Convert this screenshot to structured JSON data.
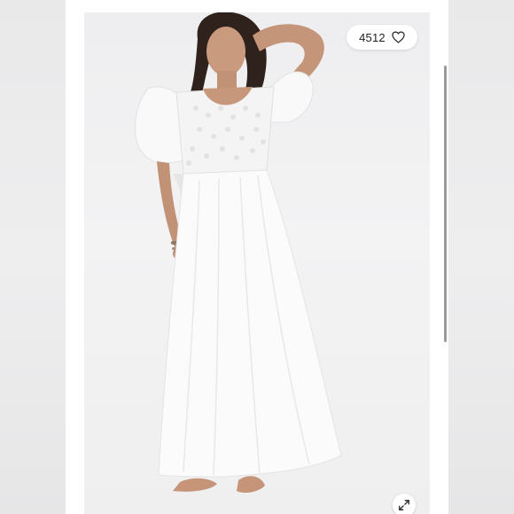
{
  "product": {
    "likes_count": "4512"
  },
  "icons": {
    "like": "heart-outline-icon",
    "expand": "expand-arrows-icon"
  },
  "colors": {
    "pill_background": "#ffffff",
    "text": "#222222",
    "scrollbar": "#9a9a9a",
    "photo_background": "#f0f0f1",
    "dress": "#fbfbfb"
  }
}
